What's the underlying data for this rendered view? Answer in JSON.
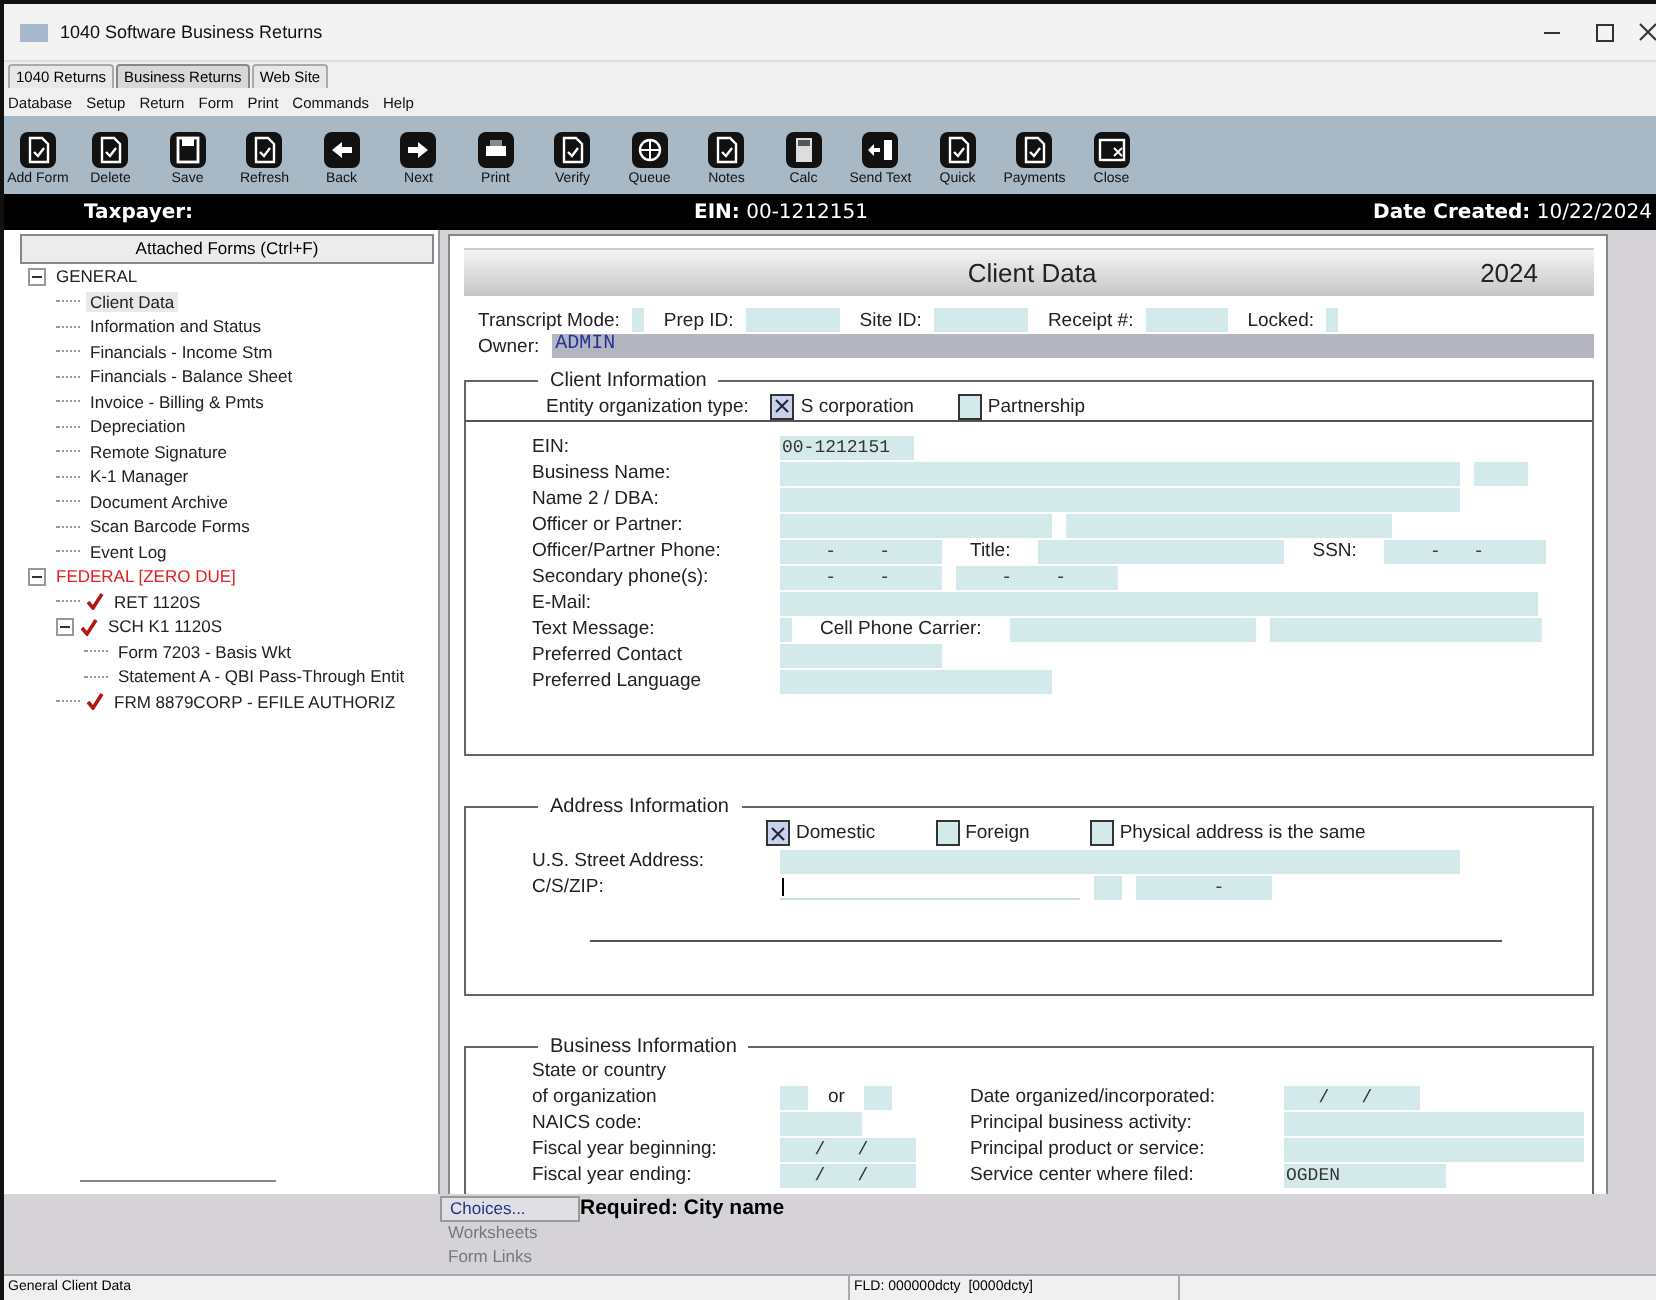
{
  "window": {
    "title": "1040 Software Business Returns"
  },
  "app_tabs": [
    {
      "label": "1040 Returns",
      "selected": false
    },
    {
      "label": "Business Returns",
      "selected": true
    },
    {
      "label": "Web Site",
      "selected": false
    }
  ],
  "menu": [
    "Database",
    "Setup",
    "Return",
    "Form",
    "Print",
    "Commands",
    "Help"
  ],
  "toolbar": [
    {
      "label": "Add Form"
    },
    {
      "label": "Delete"
    },
    {
      "label": "Save"
    },
    {
      "label": "Refresh"
    },
    {
      "label": "Back"
    },
    {
      "label": "Next"
    },
    {
      "label": "Print"
    },
    {
      "label": "Verify"
    },
    {
      "label": "Queue"
    },
    {
      "label": "Notes"
    },
    {
      "label": "Calc"
    },
    {
      "label": "Send Text"
    },
    {
      "label": "Quick"
    },
    {
      "label": "Payments"
    },
    {
      "label": "Close"
    }
  ],
  "header": {
    "taxpayer": "Taxpayer:",
    "ein": "**EIN:** 00-1212151",
    "date": "**Date Created:** 10/22/2024"
  },
  "sidebar": {
    "button": "Attached Forms (Ctrl+F)",
    "tree": [
      {
        "label": "GENERAL",
        "expanded": true,
        "warning": false,
        "checked": false,
        "selected": false,
        "children": [
          {
            "label": "Client Data",
            "warning": false,
            "checked": false,
            "selected": true
          },
          {
            "label": "Information and Status",
            "warning": false,
            "checked": false,
            "selected": false
          },
          {
            "label": "Financials - Income Stm",
            "warning": false,
            "checked": false,
            "selected": false
          },
          {
            "label": "Financials - Balance Sheet",
            "warning": false,
            "checked": false,
            "selected": false
          },
          {
            "label": "Invoice - Billing & Pmts",
            "warning": false,
            "checked": false,
            "selected": false
          },
          {
            "label": "Depreciation",
            "warning": false,
            "checked": false,
            "selected": false
          },
          {
            "label": "Remote Signature",
            "warning": false,
            "checked": false,
            "selected": false
          },
          {
            "label": "K-1 Manager",
            "warning": false,
            "checked": false,
            "selected": false
          },
          {
            "label": "Document Archive",
            "warning": false,
            "checked": false,
            "selected": false
          },
          {
            "label": "Scan Barcode Forms",
            "warning": false,
            "checked": false,
            "selected": false
          },
          {
            "label": "Event Log",
            "warning": false,
            "checked": false,
            "selected": false
          }
        ]
      },
      {
        "label": "FEDERAL [ZERO DUE]",
        "expanded": true,
        "warning": true,
        "checked": false,
        "selected": false,
        "children": [
          {
            "label": "RET 1120S",
            "warning": false,
            "checked": true,
            "selected": false
          },
          {
            "label": "SCH K1 1120S",
            "expanded": true,
            "warning": false,
            "checked": true,
            "selected": false,
            "children": [
              {
                "label": "Form 7203 - Basis Wkt",
                "warning": false,
                "checked": false,
                "selected": false
              },
              {
                "label": "Statement A - QBI Pass-Through Entit",
                "warning": false,
                "checked": false,
                "selected": false
              }
            ]
          },
          {
            "label": "FRM 8879CORP - EFILE AUTHORIZ",
            "warning": false,
            "checked": true,
            "selected": false
          }
        ]
      }
    ]
  },
  "form": {
    "title": "Client Data",
    "year": "2024",
    "top_fields": [
      {
        "label": "Transcript Mode:",
        "kind": "tiny"
      },
      {
        "label": "Prep ID:",
        "kind": "medium"
      },
      {
        "label": "Site ID:",
        "kind": "medium"
      },
      {
        "label": "Receipt #:",
        "kind": "code"
      },
      {
        "label": "Locked:",
        "kind": "tiny"
      }
    ],
    "owner": {
      "label": "Owner:",
      "value": "ADMIN"
    },
    "sections": [
      {
        "kind": "client",
        "title": "Client Information",
        "entity": {
          "label": "Entity organization type:",
          "options": [
            {
              "label": "S corporation",
              "checked": true
            },
            {
              "label": "Partnership",
              "checked": false
            }
          ]
        },
        "rows": [
          {
            "label": "EIN:",
            "cells": [
              {
                "kind": "ein",
                "value": "00-1212151"
              }
            ]
          },
          {
            "label": "Business Name:",
            "cells": [
              {
                "kind": "long"
              },
              {
                "kind": "small"
              }
            ]
          },
          {
            "label": "Name 2 / DBA:",
            "cells": [
              {
                "kind": "long"
              }
            ]
          },
          {
            "label": "Officer or Partner:",
            "cells": [
              {
                "kind": "half"
              },
              {
                "kind": "large"
              }
            ]
          },
          {
            "label": "Officer/Partner Phone:",
            "cells": [
              {
                "kind": "phone",
                "value": "    -    -"
              },
              {
                "kind": "label",
                "text": "Title:"
              },
              {
                "kind": "wide"
              },
              {
                "kind": "label",
                "text": "SSN:"
              },
              {
                "kind": "phone",
                "value": "    -   -"
              }
            ]
          },
          {
            "label": "Secondary phone(s):",
            "cells": [
              {
                "kind": "phone",
                "value": "    -    -"
              },
              {
                "kind": "phone",
                "value": "    -    -"
              }
            ]
          },
          {
            "label": "E-Mail:",
            "cells": [
              {
                "kind": "full"
              }
            ]
          },
          {
            "label": "Text Message:",
            "cells": [
              {
                "kind": "tiny"
              },
              {
                "kind": "label",
                "text": "Cell Phone Carrier:"
              },
              {
                "kind": "wide"
              },
              {
                "kind": "half"
              }
            ]
          },
          {
            "label": "Preferred Contact",
            "cells": [
              {
                "kind": "phone"
              }
            ]
          },
          {
            "label": "Preferred Language",
            "cells": [
              {
                "kind": "half"
              }
            ]
          }
        ]
      },
      {
        "kind": "address",
        "title": "Address Information",
        "options": [
          {
            "label": "Domestic",
            "checked": true
          },
          {
            "label": "Foreign",
            "checked": false
          },
          {
            "label": "Physical address is the same",
            "checked": false
          }
        ],
        "rows": [
          {
            "label": "U.S. Street Address:",
            "cells": [
              {
                "kind": "long"
              }
            ]
          },
          {
            "label": "C/S/ZIP:",
            "cells": [
              {
                "kind": "entry"
              },
              {
                "kind": "xs"
              },
              {
                "kind": "date",
                "value": "       -"
              }
            ]
          }
        ]
      },
      {
        "kind": "business",
        "title": "Business Information",
        "rows": [
          {
            "label": "State or country"
          },
          {
            "label": "of organization",
            "cells": [
              {
                "kind": "xs"
              },
              {
                "kind": "label",
                "text": "or"
              },
              {
                "kind": "xs"
              }
            ],
            "right": {
              "label": "Date organized/incorporated:",
              "field": {
                "kind": "date",
                "value": "   /   /"
              }
            }
          },
          {
            "label": "NAICS code:",
            "cells": [
              {
                "kind": "code"
              }
            ],
            "right": {
              "label": "Principal business activity:",
              "field": {
                "kind": "city"
              }
            }
          },
          {
            "label": "Fiscal year beginning:",
            "cells": [
              {
                "kind": "date",
                "value": "   /   /"
              }
            ],
            "right": {
              "label": "Principal product or service:",
              "field": {
                "kind": "city"
              }
            }
          },
          {
            "label": "Fiscal year ending:",
            "cells": [
              {
                "kind": "date",
                "value": "   /   /"
              }
            ],
            "right": {
              "label": "Service center where filed:",
              "field": {
                "kind": "phone",
                "value": "OGDEN"
              }
            }
          }
        ]
      }
    ]
  },
  "bottom": {
    "links": [
      {
        "label": "Choices...",
        "disabled": false
      },
      {
        "label": "Worksheets",
        "disabled": true
      },
      {
        "label": "Form Links",
        "disabled": true
      }
    ],
    "message": "Required: City name"
  },
  "status_bar": [
    "General Client Data",
    "FLD: 000000dcty  [0000dcty]"
  ]
}
